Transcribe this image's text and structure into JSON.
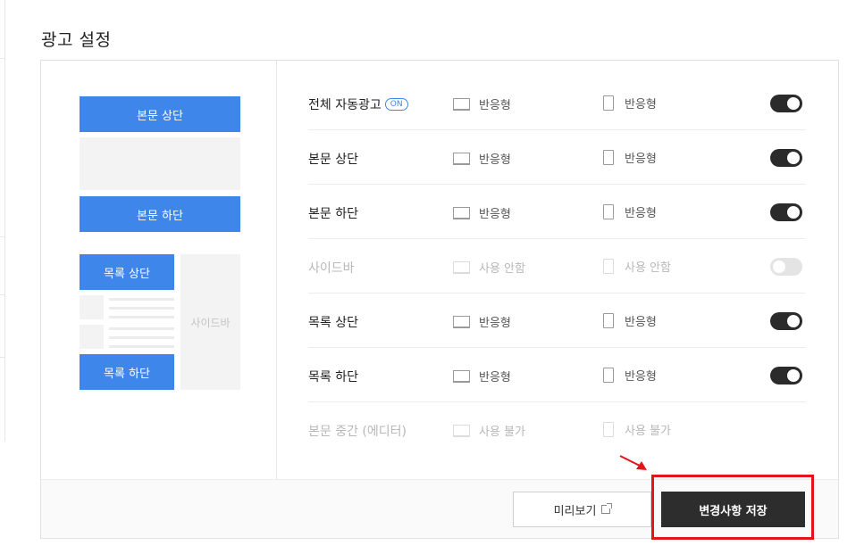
{
  "section": {
    "title": "광고 설정"
  },
  "preview": {
    "body_top": "본문 상단",
    "body_bottom": "본문 하단",
    "list_top": "목록 상단",
    "list_bottom": "목록 하단",
    "sidebar": "사이드바"
  },
  "rows": [
    {
      "label": "전체 자동광고",
      "badge": "ON",
      "pc": "반응형",
      "mobile": "반응형",
      "toggle": "on"
    },
    {
      "label": "본문 상단",
      "pc": "반응형",
      "mobile": "반응형",
      "toggle": "on"
    },
    {
      "label": "본문 하단",
      "pc": "반응형",
      "mobile": "반응형",
      "toggle": "on"
    },
    {
      "label": "사이드바",
      "pc": "사용 안함",
      "mobile": "사용 안함",
      "toggle": "off"
    },
    {
      "label": "목록 상단",
      "pc": "반응형",
      "mobile": "반응형",
      "toggle": "on"
    },
    {
      "label": "목록 하단",
      "pc": "반응형",
      "mobile": "반응형",
      "toggle": "on"
    },
    {
      "label": "본문 중간 (에디터)",
      "pc": "사용 불가",
      "mobile": "사용 불가",
      "toggle": "none"
    }
  ],
  "footer": {
    "preview_label": "미리보기",
    "save_label": "변경사항 저장"
  },
  "colors": {
    "accent": "#3f86ea",
    "highlight": "#e3141a",
    "save_bg": "#2d2d2d"
  },
  "icons": [
    "monitor-icon",
    "phone-icon",
    "external-link-icon",
    "arrow-icon"
  ]
}
